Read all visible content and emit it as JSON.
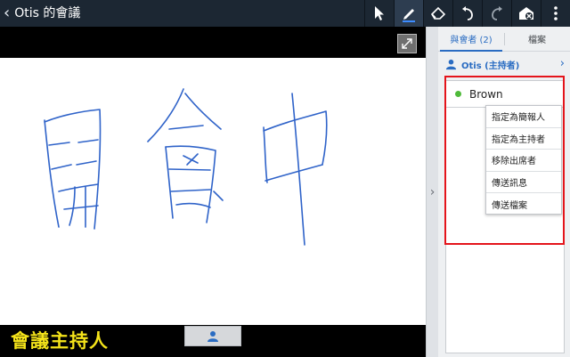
{
  "app": {
    "back_icon": "chevron-left-icon",
    "title": "Otis 的會議"
  },
  "toolbar": {
    "tools": [
      {
        "name": "pointer-icon",
        "active": false
      },
      {
        "name": "pen-icon",
        "active": true
      },
      {
        "name": "eraser-icon",
        "active": false
      },
      {
        "name": "undo-icon",
        "active": false
      },
      {
        "name": "redo-icon",
        "active": false
      },
      {
        "name": "clear-icon",
        "active": false
      },
      {
        "name": "more-icon",
        "active": false
      }
    ]
  },
  "canvas": {
    "expand_icon": "expand-icon",
    "ink_color": "#2f63c9"
  },
  "bottom": {
    "label": "會議主持人",
    "label_color": "#f4e31a",
    "host_button_icon": "person-icon"
  },
  "panel": {
    "tabs": [
      {
        "label": "與會者 (2)",
        "active": true
      },
      {
        "label": "檔案",
        "active": false
      }
    ],
    "host": {
      "label": "Otis (主持者)",
      "icon": "person-icon"
    },
    "participants": [
      {
        "name": "Brown",
        "status": "online",
        "status_color": "#4fba3a"
      }
    ],
    "context_menu": [
      "指定為簡報人",
      "指定為主持者",
      "移除出席者",
      "傳送訊息",
      "傳送檔案"
    ],
    "highlight_color": "#e4141b"
  }
}
